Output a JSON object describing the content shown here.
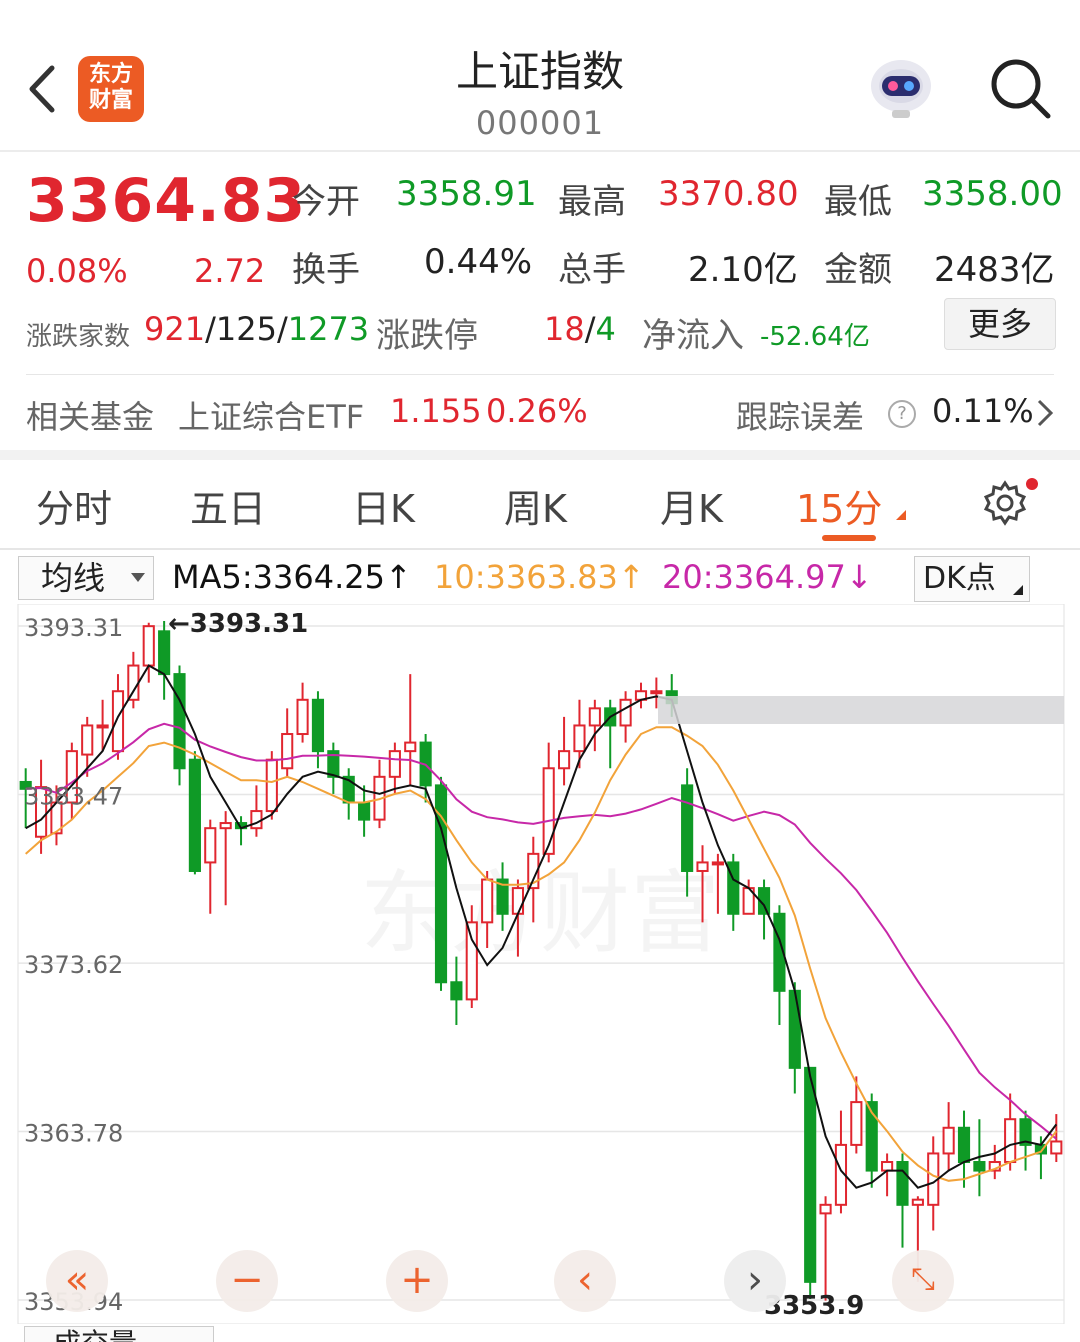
{
  "header": {
    "logo_line1": "东方",
    "logo_line2": "财富",
    "title": "上证指数",
    "code": "000001"
  },
  "quote": {
    "price": "3364.83",
    "change_pct": "0.08%",
    "change": "2.72",
    "open_label": "今开",
    "open": "3358.91",
    "high_label": "最高",
    "high": "3370.80",
    "low_label": "最低",
    "low": "3358.00",
    "turnover_label": "换手",
    "turnover": "0.44%",
    "volume_label": "总手",
    "volume": "2.10亿",
    "amount_label": "金额",
    "amount": "2483亿",
    "breadth_label": "涨跌家数",
    "breadth_up": "921",
    "breadth_sep1": "/",
    "breadth_flat": "125",
    "breadth_sep2": "/",
    "breadth_down": "1273",
    "limit_label": "涨跌停",
    "limit_up": "18",
    "limit_sep": "/",
    "limit_down": "4",
    "netflow_label": "净流入",
    "netflow": "-52.64亿",
    "more_label": "更多"
  },
  "fund": {
    "label": "相关基金",
    "name": "上证综合ETF",
    "price": "1.155",
    "pct": "0.26%",
    "track_label": "跟踪误差",
    "help": "?",
    "track_value": "0.11%"
  },
  "tabs": [
    "分时",
    "五日",
    "日K",
    "周K",
    "月K",
    "15分"
  ],
  "active_tab": "15分",
  "ma_bar": {
    "select": "均线",
    "ma5": "MA5:3364.25↑",
    "ma10": "10:3363.83↑",
    "ma20": "20:3364.97↓",
    "dk": "DK点"
  },
  "colors": {
    "up": "#e0262f",
    "down": "#0f9a26",
    "ma5": "#111111",
    "ma10": "#f2a33a",
    "ma20": "#c728a8",
    "accent": "#ec5b24"
  },
  "chart_data": {
    "type": "candlestick",
    "y_ticks": [
      "3393.31",
      "3383.47",
      "3373.62",
      "3363.78",
      "3353.94"
    ],
    "max_marker": "←3393.31",
    "min_marker": "3353.9",
    "watermark": "东方财富",
    "series_names": [
      "MA5",
      "MA10",
      "MA20"
    ],
    "candles": [
      [
        3384.2,
        3383.8,
        3385.0,
        3381.5
      ],
      [
        3381.0,
        3383.9,
        3385.5,
        3380.0
      ],
      [
        3381.2,
        3383.0,
        3384.0,
        3380.5
      ],
      [
        3383.0,
        3386.0,
        3386.5,
        3382.0
      ],
      [
        3385.8,
        3387.5,
        3388.0,
        3384.5
      ],
      [
        3387.5,
        3387.5,
        3389.0,
        3386.0
      ],
      [
        3386.0,
        3389.5,
        3390.5,
        3385.5
      ],
      [
        3389.0,
        3391.0,
        3391.8,
        3388.5
      ],
      [
        3391.0,
        3393.3,
        3393.5,
        3390.0
      ],
      [
        3393.0,
        3390.5,
        3393.6,
        3389.0
      ],
      [
        3390.5,
        3385.0,
        3391.0,
        3384.0
      ],
      [
        3385.5,
        3379.0,
        3386.0,
        3378.8
      ],
      [
        3379.5,
        3381.5,
        3382.0,
        3376.5
      ],
      [
        3381.5,
        3381.8,
        3382.5,
        3377.0
      ],
      [
        3381.8,
        3381.5,
        3382.2,
        3380.5
      ],
      [
        3381.5,
        3382.5,
        3384.0,
        3381.0
      ],
      [
        3382.5,
        3385.5,
        3386.0,
        3382.0
      ],
      [
        3385.0,
        3387.0,
        3388.5,
        3384.5
      ],
      [
        3387.0,
        3389.0,
        3390.0,
        3386.5
      ],
      [
        3389.0,
        3386.0,
        3389.5,
        3385.0
      ],
      [
        3386.0,
        3384.5,
        3386.5,
        3383.5
      ],
      [
        3384.5,
        3383.0,
        3385.0,
        3382.0
      ],
      [
        3383.0,
        3382.0,
        3384.0,
        3381.0
      ],
      [
        3382.0,
        3384.5,
        3385.5,
        3381.5
      ],
      [
        3384.5,
        3386.0,
        3386.5,
        3383.5
      ],
      [
        3386.0,
        3386.5,
        3390.5,
        3384.0
      ],
      [
        3386.5,
        3384.0,
        3387.0,
        3383.0
      ],
      [
        3384.0,
        3372.5,
        3384.5,
        3372.0
      ],
      [
        3372.5,
        3371.5,
        3374.0,
        3370.0
      ],
      [
        3371.5,
        3376.0,
        3377.0,
        3371.0
      ],
      [
        3376.0,
        3378.5,
        3379.0,
        3374.5
      ],
      [
        3378.5,
        3376.5,
        3379.5,
        3375.5
      ],
      [
        3376.5,
        3378.0,
        3378.5,
        3374.0
      ],
      [
        3378.0,
        3380.0,
        3381.0,
        3376.0
      ],
      [
        3380.0,
        3385.0,
        3386.5,
        3379.5
      ],
      [
        3385.0,
        3386.0,
        3388.0,
        3384.0
      ],
      [
        3386.0,
        3387.5,
        3389.0,
        3385.0
      ],
      [
        3387.5,
        3388.5,
        3389.0,
        3386.0
      ],
      [
        3388.5,
        3387.5,
        3389.0,
        3385.0
      ],
      [
        3387.5,
        3389.0,
        3389.5,
        3386.5
      ],
      [
        3389.0,
        3389.5,
        3390.0,
        3388.5
      ],
      [
        3389.5,
        3389.5,
        3390.3,
        3388.5
      ],
      [
        3389.5,
        3388.8,
        3390.5,
        3388.0
      ],
      [
        3384.0,
        3379.0,
        3385.0,
        3377.5
      ],
      [
        3379.0,
        3379.5,
        3380.5,
        3376.0
      ],
      [
        3379.5,
        3379.5,
        3380.0,
        3376.5
      ],
      [
        3379.5,
        3376.5,
        3380.0,
        3375.5
      ],
      [
        3376.5,
        3378.0,
        3378.5,
        3376.5
      ],
      [
        3378.0,
        3376.5,
        3378.5,
        3375.0
      ],
      [
        3376.5,
        3372.0,
        3377.0,
        3370.0
      ],
      [
        3372.0,
        3367.5,
        3372.5,
        3366.0
      ],
      [
        3367.5,
        3355.0,
        3367.0,
        3354.0
      ],
      [
        3359.0,
        3359.5,
        3360.0,
        3353.9
      ],
      [
        3359.5,
        3363.0,
        3365.0,
        3359.0
      ],
      [
        3363.0,
        3365.5,
        3367.0,
        3362.5
      ],
      [
        3365.5,
        3361.5,
        3366.0,
        3360.5
      ],
      [
        3361.5,
        3362.0,
        3362.5,
        3360.0
      ],
      [
        3362.0,
        3359.5,
        3362.5,
        3357.0
      ],
      [
        3359.5,
        3359.8,
        3360.0,
        3355.0
      ],
      [
        3359.5,
        3362.5,
        3363.5,
        3358.0
      ],
      [
        3362.5,
        3364.0,
        3365.5,
        3361.5
      ],
      [
        3364.0,
        3362.0,
        3365.0,
        3360.5
      ],
      [
        3362.0,
        3361.5,
        3364.5,
        3360.0
      ],
      [
        3361.5,
        3362.0,
        3363.0,
        3361.0
      ],
      [
        3362.0,
        3364.5,
        3366.0,
        3361.5
      ],
      [
        3364.5,
        3363.0,
        3365.0,
        3361.5
      ],
      [
        3363.0,
        3362.5,
        3363.5,
        3361.0
      ],
      [
        3362.5,
        3363.2,
        3364.8,
        3362.0
      ]
    ],
    "ma5": [
      3381.5,
      3382,
      3383,
      3384,
      3385,
      3386,
      3388,
      3389.5,
      3391,
      3390.5,
      3389,
      3387,
      3384.5,
      3383,
      3381.5,
      3381.8,
      3382.3,
      3383.5,
      3384.5,
      3384.8,
      3384.6,
      3384.3,
      3383.7,
      3383.5,
      3383.8,
      3384.0,
      3383.8,
      3381.5,
      3378,
      3375,
      3373.5,
      3374.5,
      3376.5,
      3378.5,
      3380.5,
      3383,
      3385.5,
      3387,
      3388,
      3388.5,
      3389,
      3389.2,
      3389,
      3386,
      3383,
      3380.5,
      3378.5,
      3378,
      3377,
      3375,
      3372,
      3367,
      3363.5,
      3361.5,
      3360.5,
      3360.8,
      3361.5,
      3361.5,
      3360.5,
      3360.8,
      3361.5,
      3362,
      3362.3,
      3362.5,
      3363,
      3363.2,
      3363,
      3364.2
    ],
    "ma10": [
      3380,
      3380.8,
      3381.3,
      3382,
      3383,
      3383.7,
      3384.5,
      3385.3,
      3386.3,
      3386.5,
      3386.2,
      3385.8,
      3385.3,
      3384.8,
      3384.3,
      3384.3,
      3384.2,
      3384.5,
      3384.2,
      3383.8,
      3383.4,
      3383.0,
      3383.0,
      3383.2,
      3383.5,
      3383.7,
      3383.2,
      3382.2,
      3380.8,
      3379.5,
      3378.5,
      3378.2,
      3378.2,
      3378.3,
      3378.8,
      3379.5,
      3380.8,
      3382.4,
      3384.3,
      3385.8,
      3387.0,
      3387.4,
      3387.4,
      3386.9,
      3386.3,
      3385.2,
      3383.7,
      3382.0,
      3380.3,
      3378.6,
      3376.4,
      3373.3,
      3370.4,
      3368.4,
      3366.6,
      3364.9,
      3363.8,
      3362.6,
      3361.8,
      3361.2,
      3360.9,
      3361.0,
      3361.3,
      3361.6,
      3362.0,
      3362.3,
      3362.6,
      3363.8
    ]
  }
}
